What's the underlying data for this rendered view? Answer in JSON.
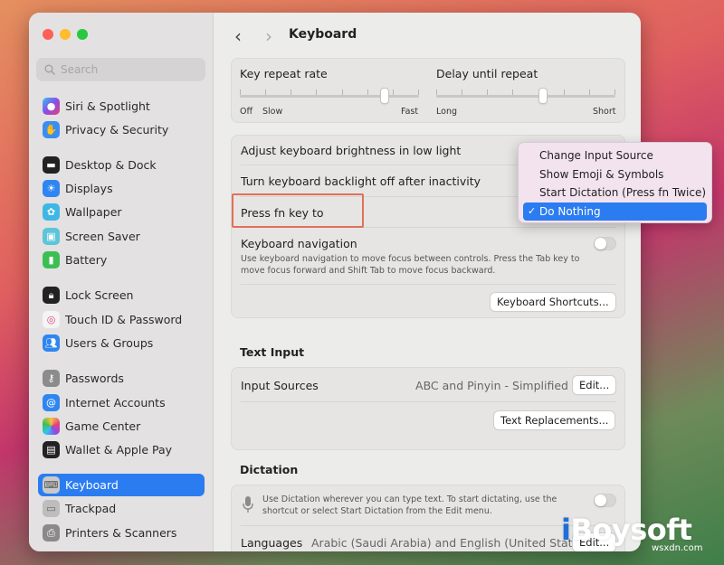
{
  "window": {
    "title": "Keyboard"
  },
  "search": {
    "placeholder": "Search"
  },
  "sidebar": {
    "items": [
      {
        "label": "Siri & Spotlight",
        "icon": "siri-icon",
        "color": "#6b5bd6"
      },
      {
        "label": "Privacy & Security",
        "icon": "hand-icon",
        "color": "#3a8ef2"
      },
      {
        "label": "Desktop & Dock",
        "icon": "dock-icon",
        "color": "#222222"
      },
      {
        "label": "Displays",
        "icon": "sun-icon",
        "color": "#2f86f0"
      },
      {
        "label": "Wallpaper",
        "icon": "flower-icon",
        "color": "#3fb7e6"
      },
      {
        "label": "Screen Saver",
        "icon": "screensaver-icon",
        "color": "#5cc5d9"
      },
      {
        "label": "Battery",
        "icon": "battery-icon",
        "color": "#3cbf52"
      },
      {
        "label": "Lock Screen",
        "icon": "lock-icon",
        "color": "#222222"
      },
      {
        "label": "Touch ID & Password",
        "icon": "fingerprint-icon",
        "color": "#f2f2f2"
      },
      {
        "label": "Users & Groups",
        "icon": "users-icon",
        "color": "#2f86f0"
      },
      {
        "label": "Passwords",
        "icon": "key-icon",
        "color": "#8c8c8c"
      },
      {
        "label": "Internet Accounts",
        "icon": "at-icon",
        "color": "#2f86f0"
      },
      {
        "label": "Game Center",
        "icon": "game-center-icon",
        "color": "#f0f0f0"
      },
      {
        "label": "Wallet & Apple Pay",
        "icon": "wallet-icon",
        "color": "#222222"
      },
      {
        "label": "Keyboard",
        "icon": "keyboard-icon",
        "color": "#9a9a9a",
        "selected": true
      },
      {
        "label": "Trackpad",
        "icon": "trackpad-icon",
        "color": "#9a9a9a"
      },
      {
        "label": "Printers & Scanners",
        "icon": "printer-icon",
        "color": "#8a8a8a"
      }
    ]
  },
  "repeat": {
    "key_repeat_label": "Key repeat rate",
    "key_repeat_off": "Off",
    "key_repeat_slow": "Slow",
    "key_repeat_fast": "Fast",
    "key_repeat_value": 0.82,
    "delay_label": "Delay until repeat",
    "delay_long": "Long",
    "delay_short": "Short",
    "delay_value": 0.6
  },
  "settings": {
    "brightness_label": "Adjust keyboard brightness in low light",
    "backlight_label": "Turn keyboard backlight off after inactivity",
    "fn_label": "Press fn key to",
    "nav_label": "Keyboard navigation",
    "nav_desc": "Use keyboard navigation to move focus between controls. Press the Tab key to move focus forward and Shift Tab to move focus backward.",
    "shortcuts_button": "Keyboard Shortcuts..."
  },
  "fn_menu": {
    "items": [
      {
        "label": "Change Input Source"
      },
      {
        "label": "Show Emoji & Symbols"
      },
      {
        "label": "Start Dictation (Press fn Twice)"
      },
      {
        "label": "Do Nothing",
        "selected": true
      }
    ],
    "check_mark": "✓"
  },
  "text_input": {
    "title": "Text Input",
    "input_sources_label": "Input Sources",
    "input_sources_value": "ABC and Pinyin - Simplified",
    "edit_button": "Edit...",
    "replacements_button": "Text Replacements..."
  },
  "dictation": {
    "title": "Dictation",
    "desc": "Use Dictation wherever you can type text. To start dictating, use the shortcut or select Start Dictation from the Edit menu.",
    "languages_label": "Languages",
    "languages_value": "Arabic (Saudi Arabia) and English (United States)",
    "edit_button": "Edit..."
  },
  "watermark": {
    "brand_i": "i",
    "brand_rest": "Boysoft",
    "url": "wsxdn.com"
  },
  "colors": {
    "accent": "#2b7cf0",
    "highlight_box": "#e0705a"
  }
}
